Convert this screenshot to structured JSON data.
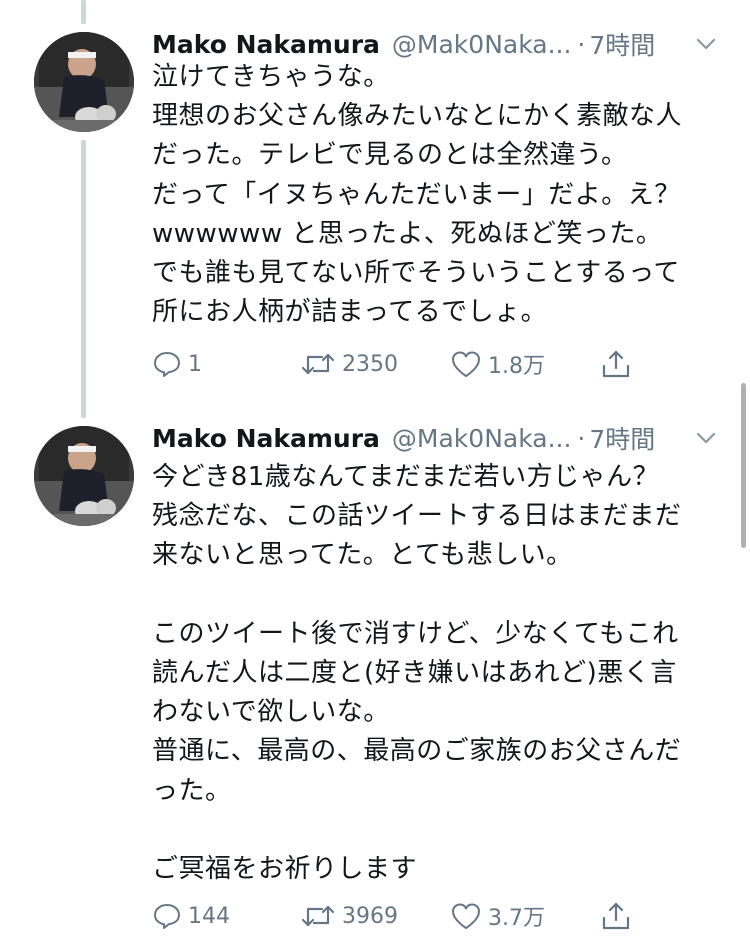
{
  "tweets": [
    {
      "author": {
        "display_name": "Mako Nakamura",
        "handle": "@Mak0Naka...",
        "avatar_icon": "user-avatar-photo"
      },
      "separator": "·",
      "time": "7時間",
      "body_lines": [
        "泣けてきちゃうな。",
        "理想のお父さん像みたいなとにかく素敵な人",
        "だった。テレビで見るのとは全然違う。",
        "だって「イヌちゃんただいまー」だよ。え？",
        "wwwwww と思ったよ、死ぬほど笑った。",
        "でも誰も見てない所でそういうことするって",
        "所にお人柄が詰まってるでしょ。"
      ],
      "actions": {
        "reply_count": "1",
        "retweet_count": "2350",
        "like_count": "1.8万",
        "reply_icon": "reply-icon",
        "retweet_icon": "retweet-icon",
        "like_icon": "heart-icon",
        "share_icon": "share-icon"
      }
    },
    {
      "author": {
        "display_name": "Mako Nakamura",
        "handle": "@Mak0Naka...",
        "avatar_icon": "user-avatar-photo"
      },
      "separator": "·",
      "time": "7時間",
      "body_lines": [
        "今どき81歳なんてまだまだ若い方じゃん？",
        "残念だな、この話ツイートする日はまだまだ",
        "来ないと思ってた。とても悲しい。",
        "",
        "このツイート後で消すけど、少なくてもこれ",
        "読んだ人は二度と(好き嫌いはあれど)悪く言",
        "わないで欲しいな。",
        "普通に、最高の、最高のご家族のお父さんだ",
        "った。",
        "",
        "ご冥福をお祈りします"
      ],
      "actions": {
        "reply_count": "144",
        "retweet_count": "3969",
        "like_count": "3.7万",
        "reply_icon": "reply-icon",
        "retweet_icon": "retweet-icon",
        "like_icon": "heart-icon",
        "share_icon": "share-icon"
      }
    }
  ],
  "colors": {
    "text": "#14171a",
    "secondary": "#657786",
    "thread_line": "#ccd6dd",
    "background": "#ffffff"
  }
}
